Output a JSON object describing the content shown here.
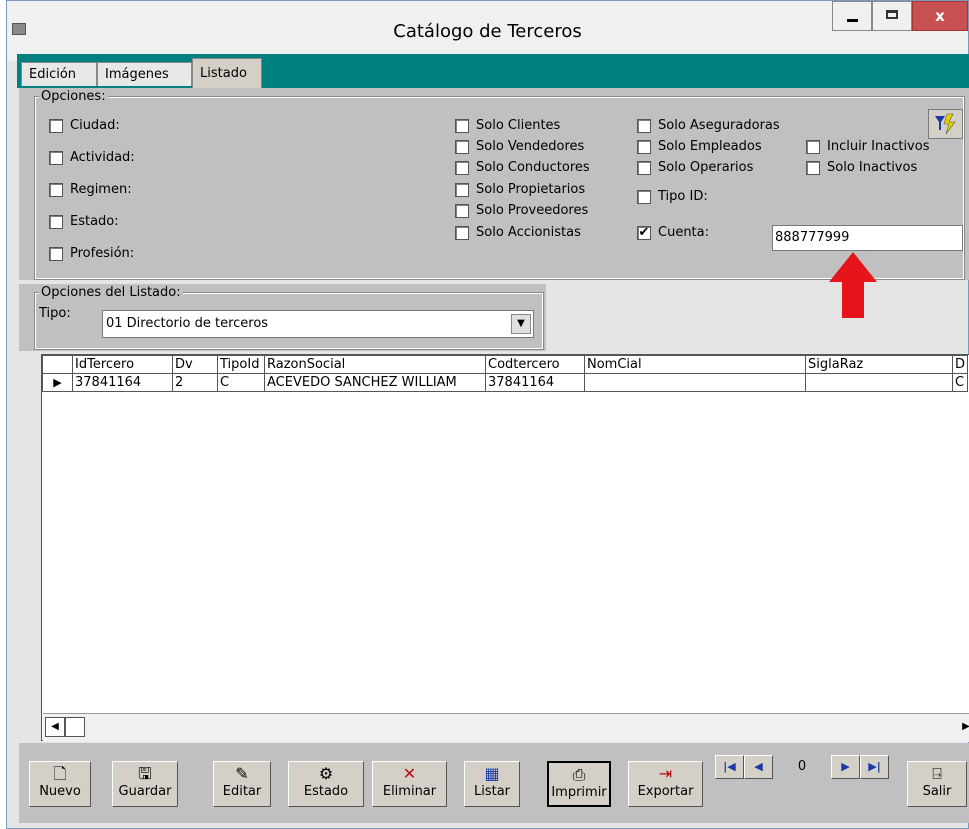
{
  "window": {
    "title": "Catálogo de Terceros",
    "minimize": "_",
    "maximize": "□",
    "close": "x"
  },
  "tabs": [
    "Edición",
    "Imágenes",
    "Listado"
  ],
  "opciones": {
    "label": "Opciones:",
    "left_checks": [
      {
        "label": "Ciudad:",
        "checked": false
      },
      {
        "label": "Actividad:",
        "checked": false
      },
      {
        "label": "Regimen:",
        "checked": false
      },
      {
        "label": "Estado:",
        "checked": false
      },
      {
        "label": "Profesión:",
        "checked": false
      }
    ],
    "mid_checks": [
      {
        "label": "Solo Clientes",
        "checked": false
      },
      {
        "label": "Solo Vendedores",
        "checked": false
      },
      {
        "label": "Solo Conductores",
        "checked": false
      },
      {
        "label": "Solo Propietarios",
        "checked": false
      },
      {
        "label": "Solo Proveedores",
        "checked": false
      },
      {
        "label": "Solo Accionistas",
        "checked": false
      }
    ],
    "right_checks": [
      {
        "label": "Solo Aseguradoras",
        "checked": false
      },
      {
        "label": "Solo Empleados",
        "checked": false
      },
      {
        "label": "Solo Operarios",
        "checked": false
      },
      {
        "label": "Tipo ID:",
        "checked": false
      },
      {
        "label": "Cuenta:",
        "checked": true
      }
    ],
    "far_checks": [
      {
        "label": "Incluir Inactivos",
        "checked": false
      },
      {
        "label": "Solo Inactivos",
        "checked": false
      }
    ],
    "cuenta_value": "888777999",
    "check_mark": "✔"
  },
  "listado": {
    "label": "Opciones del Listado:",
    "tipo_label": "Tipo:",
    "tipo_value": "01  Directorio de terceros",
    "dropdown_arrow": "▼"
  },
  "grid": {
    "columns": [
      "IdTercero",
      "Dv",
      "TipoId",
      "RazonSocial",
      "Codtercero",
      "NomCial",
      "SiglaRaz",
      "D"
    ],
    "rows": [
      [
        "37841164",
        "2",
        "C",
        "ACEVEDO SANCHEZ WILLIAM",
        "37841164",
        "",
        "",
        "C"
      ]
    ],
    "row_indicator": "▶",
    "scroll_left": "◀",
    "scroll_right": "▶"
  },
  "toolbar": {
    "buttons": [
      {
        "label": "Nuevo",
        "icon": "new-document-icon",
        "glyph": "🗋"
      },
      {
        "label": "Guardar",
        "icon": "save-disk-icon",
        "glyph": "🖫"
      },
      {
        "label": "Editar",
        "icon": "edit-icon",
        "glyph": "✎"
      },
      {
        "label": "Estado",
        "icon": "status-icon",
        "glyph": "⚙"
      },
      {
        "label": "Eliminar",
        "icon": "delete-x-icon",
        "glyph": "✕"
      },
      {
        "label": "Listar",
        "icon": "list-calendar-icon",
        "glyph": "▦"
      },
      {
        "label": "Imprimir",
        "icon": "printer-icon",
        "glyph": "⎙"
      },
      {
        "label": "Exportar",
        "icon": "export-icon",
        "glyph": "⇥"
      },
      {
        "label": "Salir",
        "icon": "exit-door-icon",
        "glyph": "⍈"
      }
    ],
    "nav": {
      "first": "|◀",
      "prev": "◀",
      "counter": "0",
      "next": "▶",
      "last": "▶|"
    }
  },
  "colors": {
    "tab_strip": "#00807f",
    "panel": "#c0c0c0",
    "arrow": "#e8141c",
    "close": "#c75050"
  }
}
